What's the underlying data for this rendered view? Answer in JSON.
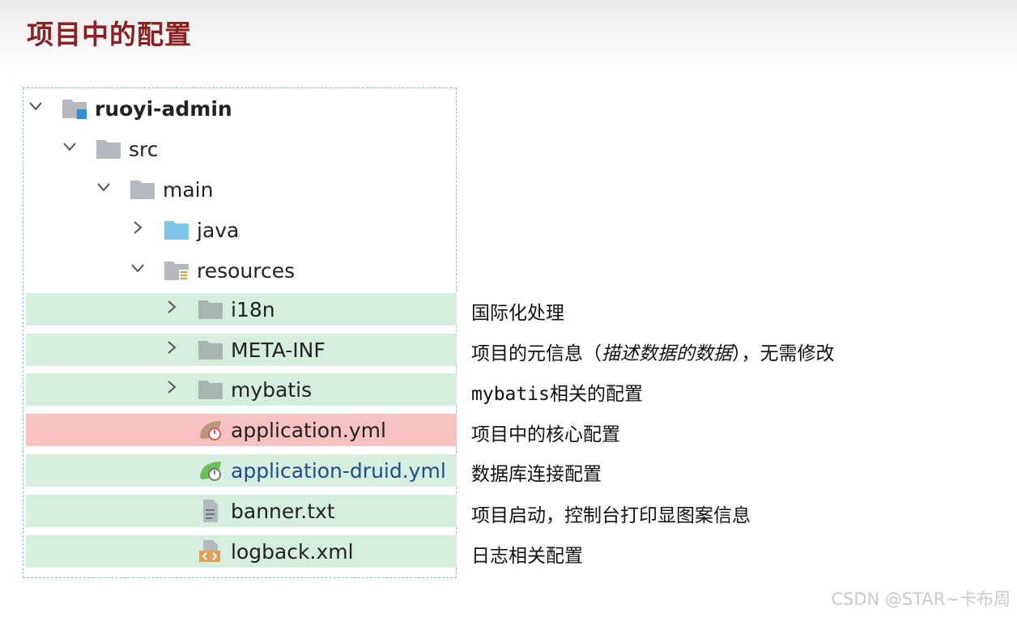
{
  "title": "项目中的配置",
  "tree": {
    "root": "ruoyi-admin",
    "src": "src",
    "main": "main",
    "java": "java",
    "resources": "resources",
    "i18n": "i18n",
    "meta_inf": "META-INF",
    "mybatis": "mybatis",
    "application_yml": "application.yml",
    "application_druid_yml": "application-druid.yml",
    "banner_txt": "banner.txt",
    "logback_xml": "logback.xml"
  },
  "notes": {
    "i18n": "国际化处理",
    "meta_inf_pre": "项目的元信息（",
    "meta_inf_em": "描述数据的数据",
    "meta_inf_post": "），无需修改",
    "mybatis_mono": "mybatis",
    "mybatis_rest": "相关的配置",
    "application_yml": "项目中的核心配置",
    "application_druid_yml": "数据库连接配置",
    "banner_txt": "项目启动，控制台打印显图案信息",
    "logback_xml": "日志相关配置"
  },
  "colors": {
    "title": "#8c1f1f",
    "row_highlight": "#d5eedd",
    "core_config_highlight": "#f8c2c2",
    "link_text": "#1f4c8f"
  },
  "icons": {
    "chevron_open": "chevron-down-icon",
    "chevron_closed": "chevron-right-icon",
    "module_folder": "module-folder-icon",
    "folder": "folder-icon",
    "source_folder": "source-folder-icon",
    "resources_folder": "resources-folder-icon",
    "spring_config": "spring-config-icon",
    "text_file": "text-file-icon",
    "xml_file": "xml-file-icon"
  },
  "watermark": "CSDN @STAR~卡布周"
}
